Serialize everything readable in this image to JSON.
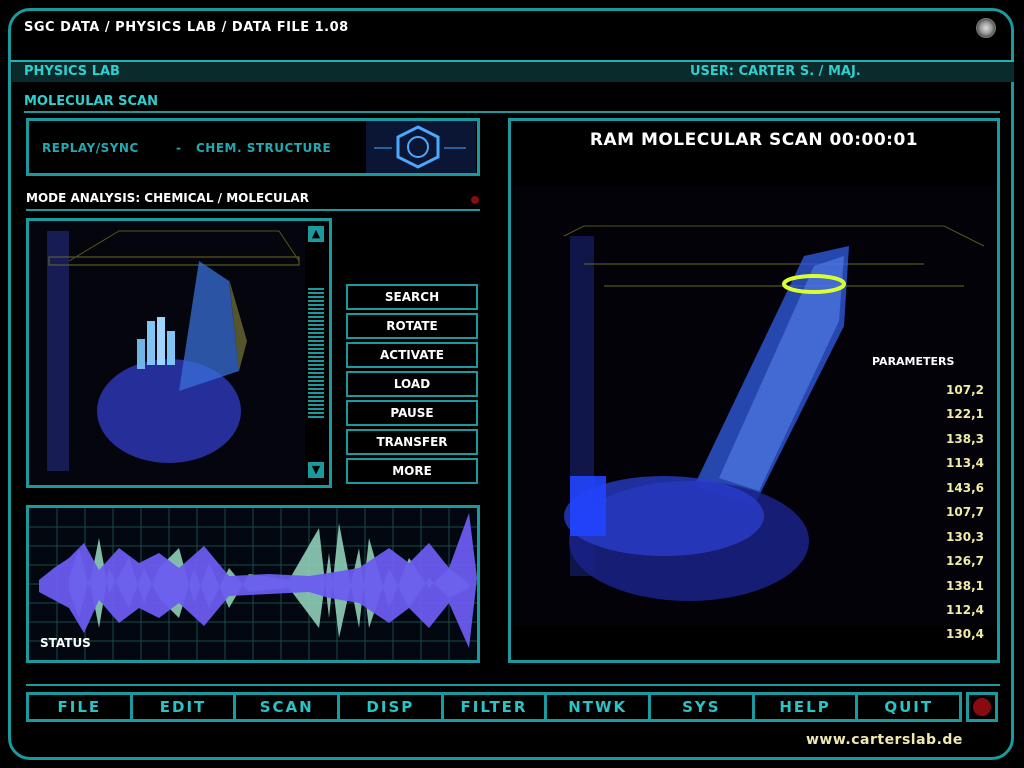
{
  "window": {
    "title": "SGC DATA / PHYSICS LAB / DATA FILE 1.08",
    "logo_icon": "stargate-logo-icon"
  },
  "header": {
    "lab": "PHYSICS LAB",
    "user": "USER: CARTER S. / MAJ."
  },
  "section_title": "MOLECULAR SCAN",
  "chem_panel": {
    "replay": "REPLAY/SYNC",
    "separator": "-",
    "structure": "CHEM. STRUCTURE",
    "icon": "benzene-ring-icon"
  },
  "mode_analysis": "MODE ANALYSIS: CHEMICAL / MOLECULAR",
  "controls": [
    "SEARCH",
    "ROTATE",
    "ACTIVATE",
    "LOAD",
    "PAUSE",
    "TRANSFER",
    "MORE"
  ],
  "scan": {
    "title": "RAM MOLECULAR SCAN 00:00:01"
  },
  "parameters": {
    "heading": "PARAMETERS",
    "values": [
      "107,2",
      "122,1",
      "138,3",
      "113,4",
      "143,6",
      "107,7",
      "130,3",
      "126,7",
      "138,1",
      "112,4",
      "130,4"
    ]
  },
  "status_label": "STATUS",
  "menu": [
    "FILE",
    "EDIT",
    "SCAN",
    "DISP",
    "FILTER",
    "NTWK",
    "SYS",
    "HELP",
    "QUIT"
  ],
  "footer_url": "www.carterslab.de",
  "colors": {
    "accent": "#1a9a9e",
    "label_cyan": "#2fcfcf",
    "value_yellow": "#f2eca6",
    "alert_red": "#8a0a12"
  }
}
